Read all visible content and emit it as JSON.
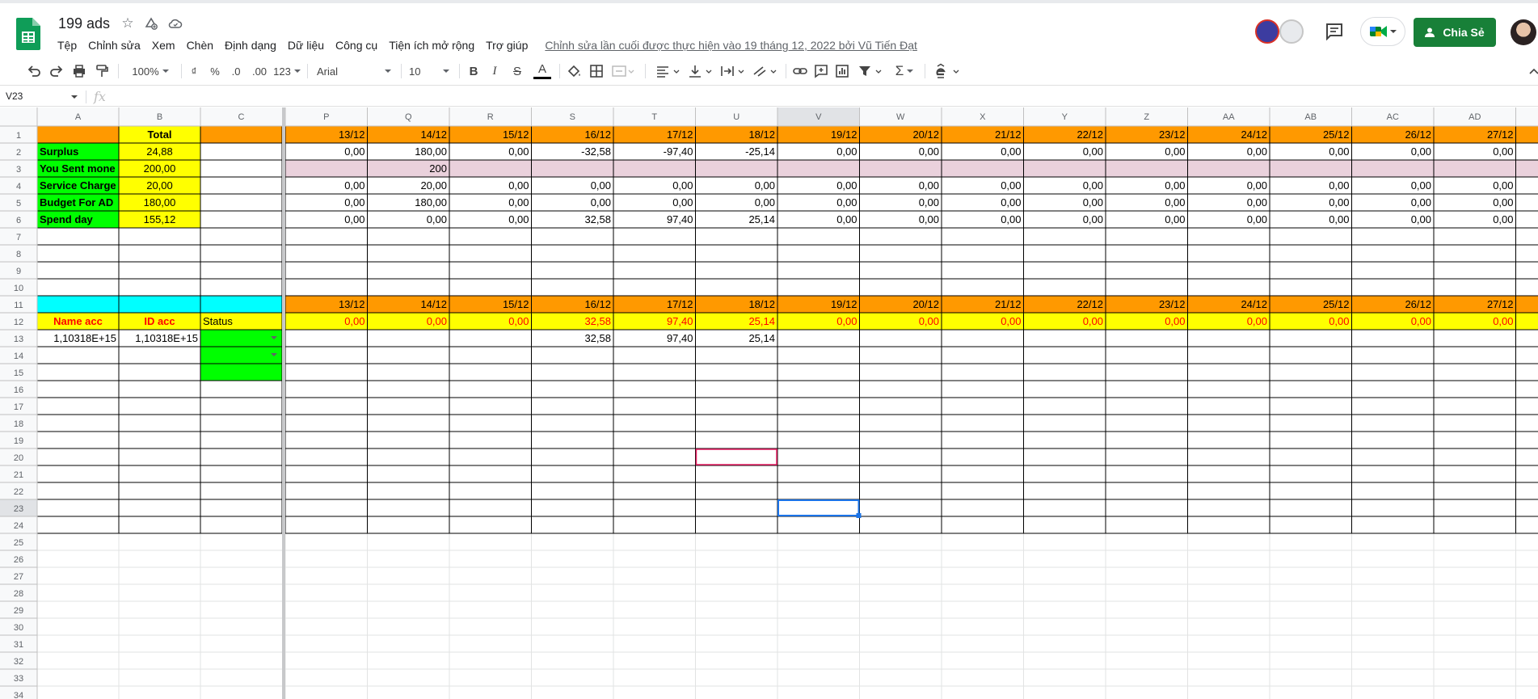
{
  "header": {
    "title": "199 ads",
    "last_edit": "Chỉnh sửa lần cuối được thực hiện vào 19 tháng 12, 2022 bởi Vũ Tiến Đạt",
    "share_label": "Chia Sẻ",
    "menu": [
      "Tệp",
      "Chỉnh sửa",
      "Xem",
      "Chèn",
      "Định dạng",
      "Dữ liệu",
      "Công cụ",
      "Tiện ích mở rộng",
      "Trợ giúp"
    ]
  },
  "toolbar": {
    "zoom": "100%",
    "currency": "₫",
    "percent": "%",
    "decimal_decrease": ".0",
    "decimal_increase": ".00",
    "more_formats": "123",
    "font": "Arial",
    "font_size": "10",
    "bold": "B",
    "italic": "I",
    "strike": "S",
    "text_color": "A",
    "sum": "Σ"
  },
  "formula_bar": {
    "name_box": "V23",
    "fx": "fx"
  },
  "colors": {
    "orange": "#ff9900",
    "yellow": "#ffff00",
    "green": "#00ff00",
    "cyan": "#00ffff",
    "pink": "#ead1dc",
    "red_text": "#ff0000",
    "selection": "#1a73e8",
    "pink_border": "#e91e63",
    "share_green": "#188038"
  },
  "sheet": {
    "frozen_columns": [
      "A",
      "B",
      "C"
    ],
    "scroll_columns": [
      "P",
      "Q",
      "R",
      "S",
      "T",
      "U",
      "V",
      "W",
      "X",
      "Y",
      "Z",
      "AA",
      "AB",
      "AC",
      "AD"
    ],
    "row_numbers": [
      "1",
      "2",
      "3",
      "4",
      "5",
      "6",
      "7",
      "8",
      "9",
      "10",
      "11",
      "12",
      "13",
      "14",
      "15",
      "16",
      "17",
      "18",
      "19",
      "20",
      "21",
      "22",
      "23",
      "24",
      "25",
      "26",
      "27",
      "28",
      "29",
      "30",
      "31",
      "32",
      "33",
      "34"
    ],
    "frozen_rows": [
      [
        "",
        "Total",
        ""
      ],
      [
        "Surplus",
        "24,88",
        ""
      ],
      [
        "You Sent mone",
        "200,00",
        ""
      ],
      [
        "Service Charge",
        "20,00",
        ""
      ],
      [
        "Budget For  AD",
        "180,00",
        ""
      ],
      [
        "Spend day",
        "155,12",
        ""
      ],
      [
        "",
        "",
        ""
      ],
      [
        "",
        "",
        ""
      ],
      [
        "",
        "",
        ""
      ],
      [
        "",
        "",
        ""
      ],
      [
        "",
        "",
        ""
      ],
      [
        "Name acc",
        "ID acc",
        "Status"
      ],
      [
        "1,10318E+15",
        "1,10318E+15",
        ""
      ]
    ],
    "scroll_rows": [
      [
        "13/12",
        "14/12",
        "15/12",
        "16/12",
        "17/12",
        "18/12",
        "19/12",
        "20/12",
        "21/12",
        "22/12",
        "23/12",
        "24/12",
        "25/12",
        "26/12",
        "27/12"
      ],
      [
        "0,00",
        "180,00",
        "0,00",
        "-32,58",
        "-97,40",
        "-25,14",
        "0,00",
        "0,00",
        "0,00",
        "0,00",
        "0,00",
        "0,00",
        "0,00",
        "0,00",
        "0,00"
      ],
      [
        "",
        "200",
        "",
        "",
        "",
        "",
        "",
        "",
        "",
        "",
        "",
        "",
        "",
        "",
        ""
      ],
      [
        "0,00",
        "20,00",
        "0,00",
        "0,00",
        "0,00",
        "0,00",
        "0,00",
        "0,00",
        "0,00",
        "0,00",
        "0,00",
        "0,00",
        "0,00",
        "0,00",
        "0,00"
      ],
      [
        "0,00",
        "180,00",
        "0,00",
        "0,00",
        "0,00",
        "0,00",
        "0,00",
        "0,00",
        "0,00",
        "0,00",
        "0,00",
        "0,00",
        "0,00",
        "0,00",
        "0,00"
      ],
      [
        "0,00",
        "0,00",
        "0,00",
        "32,58",
        "97,40",
        "25,14",
        "0,00",
        "0,00",
        "0,00",
        "0,00",
        "0,00",
        "0,00",
        "0,00",
        "0,00",
        "0,00"
      ],
      [],
      [],
      [],
      [],
      [
        "13/12",
        "14/12",
        "15/12",
        "16/12",
        "17/12",
        "18/12",
        "19/12",
        "20/12",
        "21/12",
        "22/12",
        "23/12",
        "24/12",
        "25/12",
        "26/12",
        "27/12"
      ],
      [
        "0,00",
        "0,00",
        "0,00",
        "32,58",
        "97,40",
        "25,14",
        "0,00",
        "0,00",
        "0,00",
        "0,00",
        "0,00",
        "0,00",
        "0,00",
        "0,00",
        "0,00"
      ],
      [
        "",
        "",
        "",
        "32,58",
        "97,40",
        "25,14",
        "",
        "",
        "",
        "",
        "",
        "",
        "",
        "",
        ""
      ]
    ],
    "selected_cell": "V23",
    "highlighted_cell": "U20"
  }
}
